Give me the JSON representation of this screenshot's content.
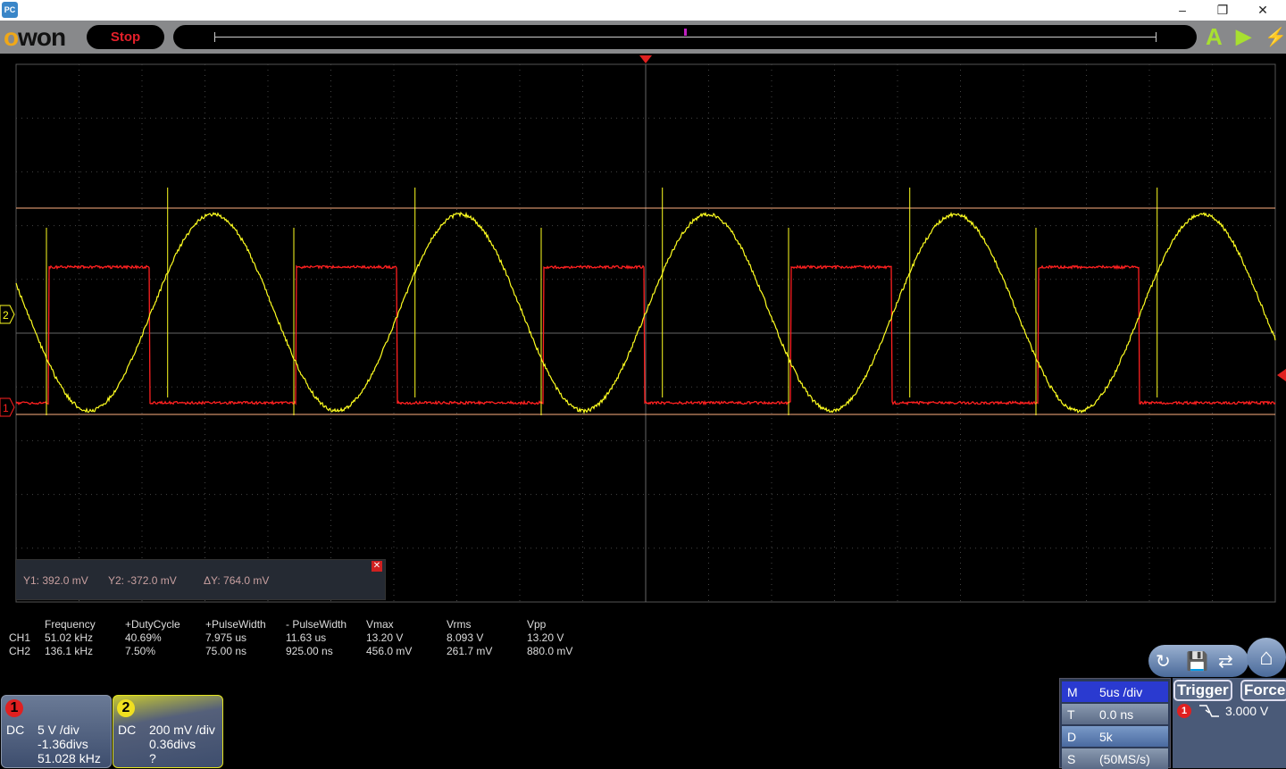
{
  "window": {
    "app_icon": "PC",
    "minimize": "–",
    "restore": "❐",
    "close": "✕"
  },
  "toolbar": {
    "logo": "OWON",
    "run_state": "Stop",
    "auto_icon": "A",
    "run_icon": "▶",
    "force_icon": "⚡"
  },
  "waveform": {
    "ch1_color": "#ff2020",
    "ch2_color": "#ffff20",
    "cursor_color": "#ffb080",
    "ch1_marker": "1",
    "ch2_marker": "2",
    "ch1_duty": 0.4069,
    "ch1_freq_khz": 51.02
  },
  "cursor": {
    "y1": "Y1: 392.0 mV",
    "y2": "Y2: -372.0 mV",
    "dy": "ΔY: 764.0 mV",
    "close": "✕"
  },
  "measurements": {
    "headers": [
      "Frequency",
      "+DutyCycle",
      "+PulseWidth",
      "- PulseWidth",
      "Vmax",
      "Vrms",
      "Vpp"
    ],
    "rows": [
      {
        "ch": "CH1",
        "values": [
          "51.02 kHz",
          "40.69%",
          "7.975 us",
          "11.63 us",
          "13.20 V",
          "8.093 V",
          "13.20 V"
        ]
      },
      {
        "ch": "CH2",
        "values": [
          "136.1 kHz",
          "7.50%",
          "75.00 ns",
          "925.00 ns",
          "456.0 mV",
          "261.7 mV",
          "880.0 mV"
        ]
      }
    ]
  },
  "channels": [
    {
      "num": "1",
      "coupling": "DC",
      "scale": "5 V /div",
      "offset": "-1.36divs",
      "freq": "51.028 kHz"
    },
    {
      "num": "2",
      "coupling": "DC",
      "scale": "200 mV /div",
      "offset": "0.36divs",
      "freq": "?"
    }
  ],
  "timebase": [
    {
      "key": "M",
      "value": "5us /div"
    },
    {
      "key": "T",
      "value": "0.0 ns"
    },
    {
      "key": "D",
      "value": "5k"
    },
    {
      "key": "S",
      "value": "(50MS/s)"
    }
  ],
  "trigger": {
    "trigger_label": "Trigger",
    "force_label": "Force",
    "source": "1",
    "slope_icon": "falling-edge",
    "level": "3.000 V"
  },
  "nav": {
    "autoset_icon": "↻",
    "save_icon": "💾",
    "switch_icon": "⇄",
    "home_icon": "⌂"
  }
}
